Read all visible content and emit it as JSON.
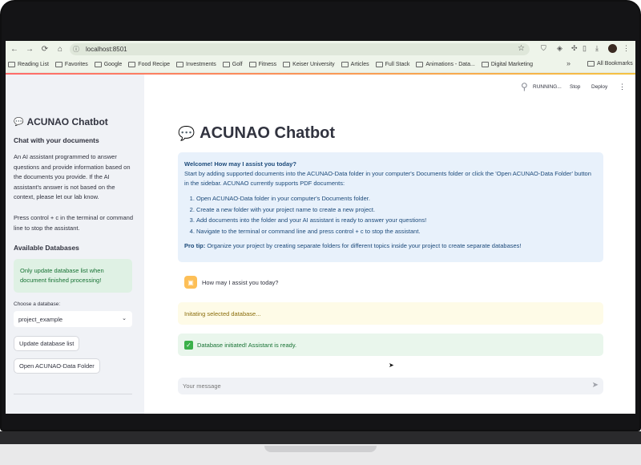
{
  "browser": {
    "url": "localhost:8501",
    "bookmarks": [
      "Reading List",
      "Favorites",
      "Google",
      "Food Recipe",
      "Investments",
      "Golf",
      "Fitness",
      "Keiser University",
      "Articles",
      "Full Stack",
      "Animations - Data...",
      "Digital Marketing"
    ],
    "more": "»",
    "all_bookmarks": "All Bookmarks"
  },
  "app": {
    "status": "RUNNING...",
    "stop_label": "Stop",
    "deploy_label": "Deploy",
    "menu_icon": "⋮"
  },
  "sidebar": {
    "title": "ACUNAO Chatbot",
    "subtitle": "Chat with your documents",
    "description": "An AI assistant programmed to answer questions and provide information based on the documents you provide. If the AI assistant's answer is not based on the context, please let our lab know.",
    "hint": "Press control + c in the terminal or command line to stop the assistant.",
    "databases_heading": "Available Databases",
    "success_note": "Only update database list when document finished processing!",
    "select_label": "Choose a database:",
    "select_value": "project_example",
    "update_button": "Update database list",
    "open_button": "Open ACUNAO-Data Folder"
  },
  "main": {
    "title": "ACUNAO Chatbot",
    "info": {
      "welcome": "Welcome! How may I assist you today?",
      "intro": "Start by adding supported documents into the ACUNAO-Data folder in your computer's Documents folder or click the 'Open ACUNAO-Data Folder' button in the sidebar. ACUNAO currently supports PDF documents:",
      "steps": [
        "Open ACUNAO-Data folder in your computer's Documents folder.",
        "Create a new folder with your project name to create a new project.",
        "Add documents into the folder and your AI assistant is ready to answer your questions!",
        "Navigate to the terminal or command line and press control + c to stop the assistant."
      ],
      "pro_tip_label": "Pro tip:",
      "pro_tip": "Organize your project by creating separate folders for different topics inside your project to create separate databases!"
    },
    "assistant_message": "How may I assist you today?",
    "warning": "Initating selected database...",
    "success": "Database initiated! Assistant is ready.",
    "chat_placeholder": "Your message"
  }
}
